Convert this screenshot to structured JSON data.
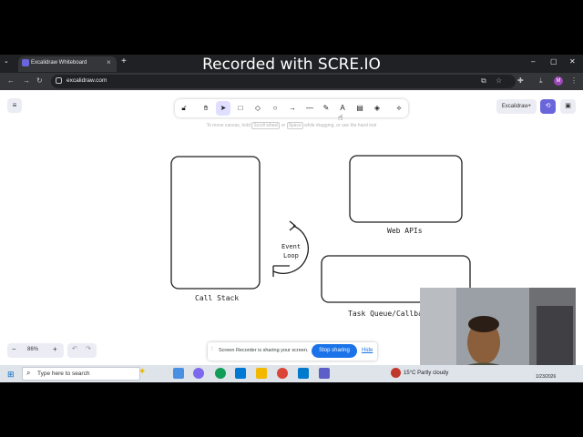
{
  "browser": {
    "tab_title": "Excalidraw Whiteboard",
    "url": "excalidraw.com",
    "profile_initial": "M"
  },
  "overlay": {
    "recorder_text": "Recorded with SCRE.IO"
  },
  "excalidraw": {
    "hint": {
      "prefix": "To move canvas, hold",
      "key1": "Scroll wheel",
      "middle": "or",
      "key2": "Space",
      "suffix": "while dragging, or use the hand tool"
    },
    "excalidraw_plus": "Excalidraw+",
    "zoom": "86%",
    "tool_numbers": [
      "",
      "1",
      "2",
      "3",
      "4",
      "5",
      "6",
      "7",
      "8",
      "9",
      "0",
      ""
    ],
    "shapes": {
      "call_stack": "Call Stack",
      "web_apis": "Web APIs",
      "event_loop_line1": "Event",
      "event_loop_line2": "Loop",
      "task_queue": "Task Queue/Callback"
    }
  },
  "screen_share": {
    "message": "Screen Recorder is sharing your screen.",
    "stop": "Stop sharing",
    "hide": "Hide"
  },
  "taskbar": {
    "search_placeholder": "Type here to search",
    "weather": "15°C  Partly cloudy",
    "date": "1/23/2026"
  },
  "colors": {
    "accent": "#6965db",
    "tool_active": "#e0dfff",
    "stop_button": "#1a73e8",
    "chrome_dark": "#202124"
  }
}
